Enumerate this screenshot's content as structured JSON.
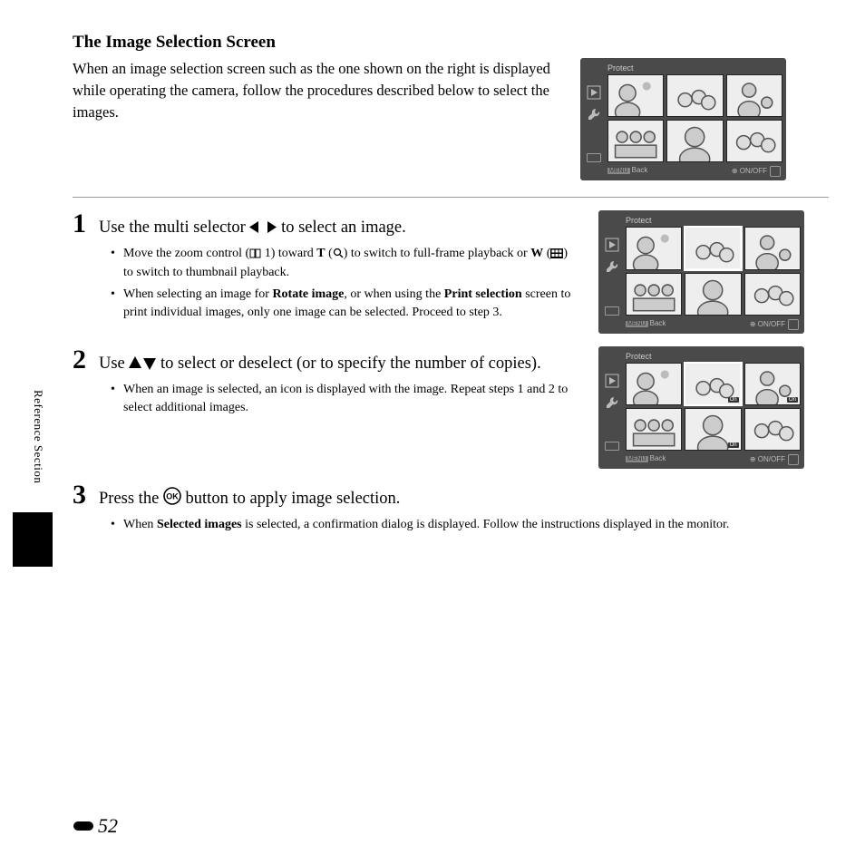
{
  "sidebar": {
    "label": "Reference Section"
  },
  "header": {
    "title": "The Image Selection Screen",
    "intro": "When an image selection screen such as the one shown on the right is displayed while operating the camera, follow the procedures described below to select the images."
  },
  "lcd": {
    "title": "Protect",
    "back": "Back",
    "onoff": "ON/OFF"
  },
  "steps": [
    {
      "num": "1",
      "title_pre": "Use the multi selector ",
      "title_post": " to select an image.",
      "bullets": [
        {
          "pre": "Move the zoom control (",
          "ref": " 1) toward ",
          "t": "T",
          "mid1": " (",
          "mid2": ") to switch to full-frame playback or ",
          "w": "W",
          "mid3": " (",
          "mid4": ") to switch to thumbnail playback."
        },
        {
          "text_a": "When selecting an image for ",
          "bold_a": "Rotate image",
          "text_b": ", or when using the ",
          "bold_b": "Print selection",
          "text_c": " screen to print individual images, only one image can be selected. Proceed to step 3."
        }
      ]
    },
    {
      "num": "2",
      "title_pre": "Use ",
      "title_post": " to select or deselect (or to specify the number of copies).",
      "bullets": [
        {
          "text": "When an image is selected, an icon is displayed with the image. Repeat steps 1 and 2 to select additional images."
        }
      ]
    },
    {
      "num": "3",
      "title_pre": "Press the ",
      "title_post": " button to apply image selection.",
      "bullets": [
        {
          "text_a": "When ",
          "bold_a": "Selected images",
          "text_b": " is selected, a confirmation dialog is displayed. Follow the instructions displayed in the monitor."
        }
      ]
    }
  ],
  "page_number": "52"
}
